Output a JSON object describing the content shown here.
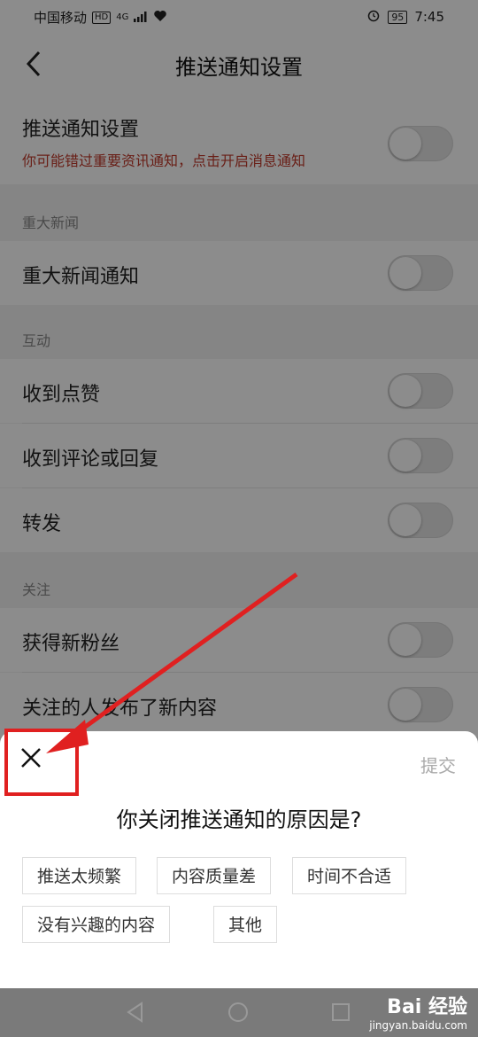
{
  "status": {
    "carrier": "中国移动",
    "hd": "HD",
    "network": "4G",
    "battery": "95",
    "time": "7:45"
  },
  "header": {
    "title": "推送通知设置"
  },
  "push": {
    "label": "推送通知设置",
    "hint": "你可能错过重要资讯通知，点击开启消息通知"
  },
  "sections": [
    {
      "title": "重大新闻",
      "items": [
        "重大新闻通知"
      ]
    },
    {
      "title": "互动",
      "items": [
        "收到点赞",
        "收到评论或回复",
        "转发"
      ]
    },
    {
      "title": "关注",
      "items": [
        "获得新粉丝",
        "关注的人发布了新内容"
      ]
    }
  ],
  "dialog": {
    "submit": "提交",
    "question": "你关闭推送通知的原因是?",
    "options": [
      "推送太频繁",
      "内容质量差",
      "时间不合适",
      "没有兴趣的内容",
      "其他"
    ]
  },
  "watermark": {
    "line1": "Bai 经验",
    "line2": "jingyan.baidu.com"
  },
  "colors": {
    "accent_red": "#e02020",
    "hint_red": "#c0392b"
  }
}
